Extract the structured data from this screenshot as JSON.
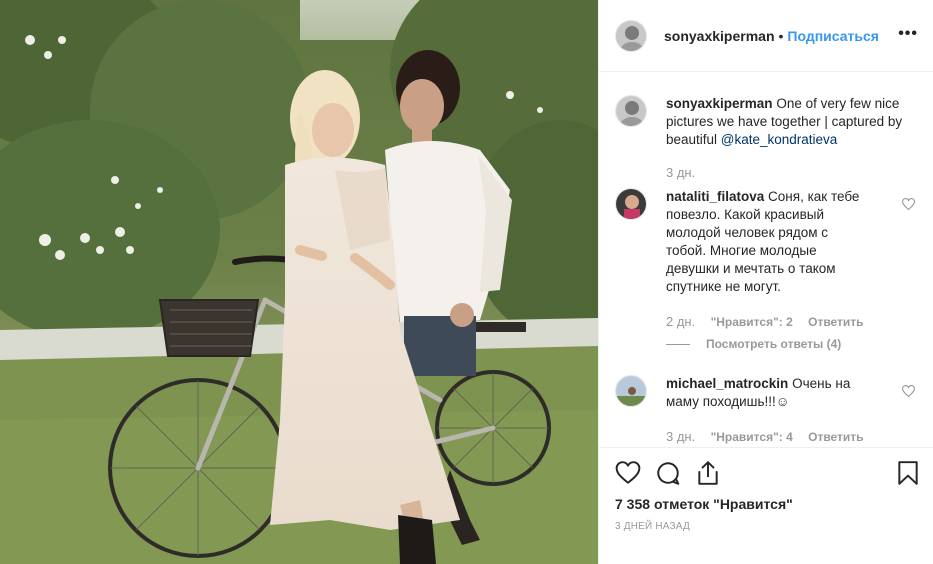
{
  "post": {
    "author": "sonyaxkiperman",
    "follow_label": "Подписаться",
    "separator": "•",
    "more_label": "•••"
  },
  "comments": [
    {
      "user": "sonyaxkiperman",
      "text": "One of very few nice pictures we have together | captured by beautiful ",
      "mention": "@kate_kondratieva",
      "time": "3 дн."
    },
    {
      "user": "nataliti_filatova",
      "text": "Соня, как тебе повезло. Какой красивый молодой человек рядом с тобой. Многие молодые девушки и мечтать о таком спутнике не могут.",
      "time": "2 дн.",
      "likes": "\"Нравится\": 2",
      "reply": "Ответить",
      "view_replies": "Посмотреть ответы (4)"
    },
    {
      "user": "michael_matrockin",
      "text": "Очень на маму походишь!!!☺",
      "time": "3 дн.",
      "likes": "\"Нравится\": 4",
      "reply": "Ответить"
    }
  ],
  "actions": {
    "like_icon": "heart-icon",
    "comment_icon": "comment-icon",
    "share_icon": "share-icon",
    "save_icon": "bookmark-icon"
  },
  "likes": {
    "count": "7 358",
    "label": "отметок \"Нравится\""
  },
  "date_label": "3 ДНЕЙ НАЗАД",
  "colors": {
    "link": "#3897f0",
    "mention": "#003569",
    "muted": "#999999",
    "text": "#262626"
  }
}
